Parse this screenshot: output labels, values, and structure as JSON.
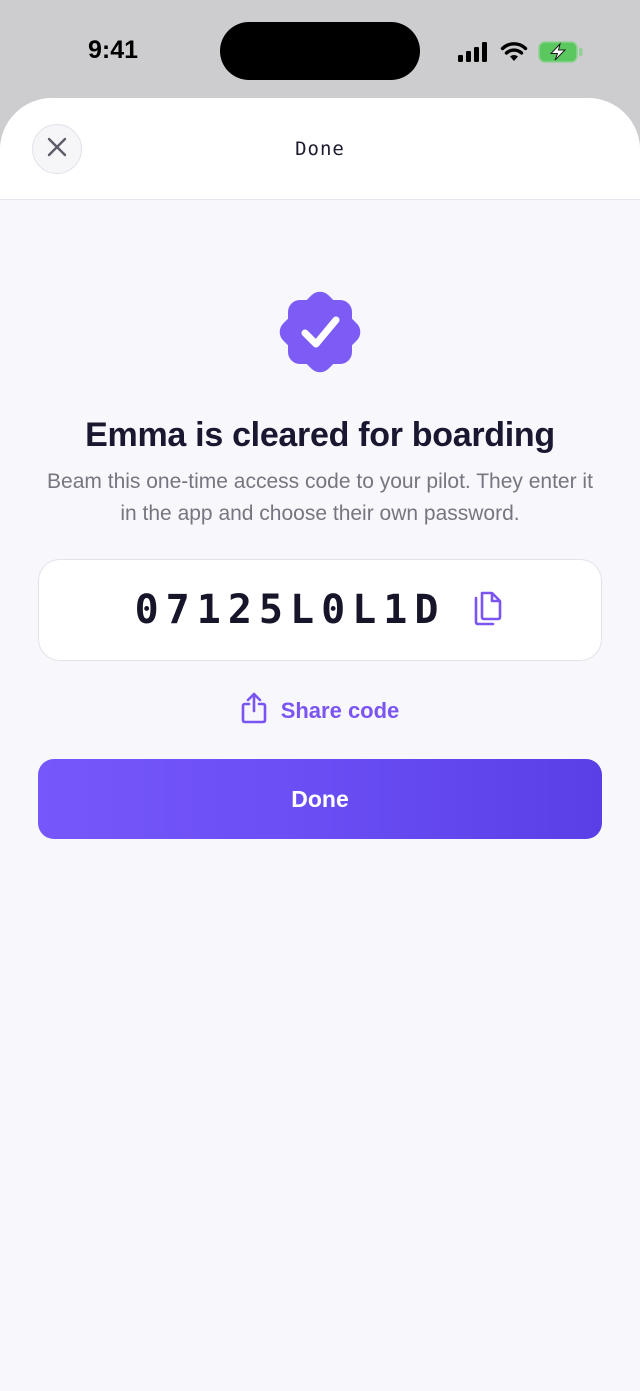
{
  "status_bar": {
    "time": "9:41"
  },
  "header": {
    "title": "Done",
    "close_icon": "close-icon"
  },
  "success": {
    "icon": "verified-badge-icon",
    "headline": "Emma is cleared for boarding",
    "description": "Beam this one-time access code to your pilot. They enter it in the app and choose their own password."
  },
  "code": {
    "value": "07125L0L1D",
    "copy_icon": "copy-icon"
  },
  "share": {
    "label": "Share code",
    "icon": "share-icon"
  },
  "primary_button": {
    "label": "Done"
  },
  "colors": {
    "accent": "#7a55f2",
    "button_start": "#7657fb",
    "button_end": "#5a3ee6",
    "sheet_background": "#f8f7fc"
  }
}
